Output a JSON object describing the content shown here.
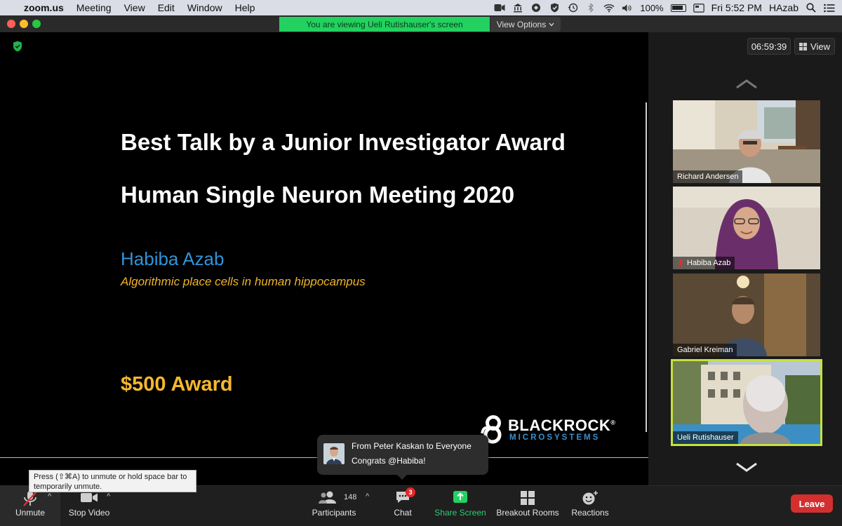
{
  "menubar": {
    "app_name": "zoom.us",
    "menus": [
      "Meeting",
      "View",
      "Edit",
      "Window",
      "Help"
    ],
    "battery_percent": "100%",
    "clock": "Fri 5:52 PM",
    "user": "HAzab"
  },
  "window": {
    "share_banner": "You are viewing Ueli Rutishauser's screen",
    "view_options_label": "View Options"
  },
  "slide": {
    "title_line1": "Best Talk by a Junior Investigator Award",
    "title_line2": "Human Single Neuron Meeting 2020",
    "author": "Habiba Azab",
    "topic": "Algorithmic place cells in human hippocampus",
    "award": "$500 Award",
    "logo_word1": "BLACKROCK",
    "logo_word2": "MICROSYSTEMS",
    "logo_mark": "®"
  },
  "gallery": {
    "timer": "06:59:39",
    "view_label": "View",
    "participants": [
      {
        "name": "Richard Andersen",
        "muted": false,
        "active": false
      },
      {
        "name": "Habiba Azab",
        "muted": true,
        "active": false
      },
      {
        "name": "Gabriel Kreiman",
        "muted": false,
        "active": false
      },
      {
        "name": "Ueli Rutishauser",
        "muted": false,
        "active": true
      }
    ]
  },
  "toolbar": {
    "unmute_label": "Unmute",
    "stop_video_label": "Stop Video",
    "participants_label": "Participants",
    "participant_count": "148",
    "chat_label": "Chat",
    "chat_badge": "3",
    "share_label": "Share Screen",
    "breakout_label": "Breakout Rooms",
    "reactions_label": "Reactions",
    "leave_label": "Leave"
  },
  "tooltip": {
    "text": "Press  (⇧⌘A) to unmute or hold space bar to temporarily unmute."
  },
  "chat_popup": {
    "from": "From Peter Kaskan to Everyone",
    "message": "Congrats @Habiba!"
  },
  "colors": {
    "share_green": "#23d160",
    "slide_blue": "#2f94d8",
    "slide_gold": "#f5b82e",
    "active_speaker": "#c6e040",
    "leave_red": "#d32f2f"
  }
}
